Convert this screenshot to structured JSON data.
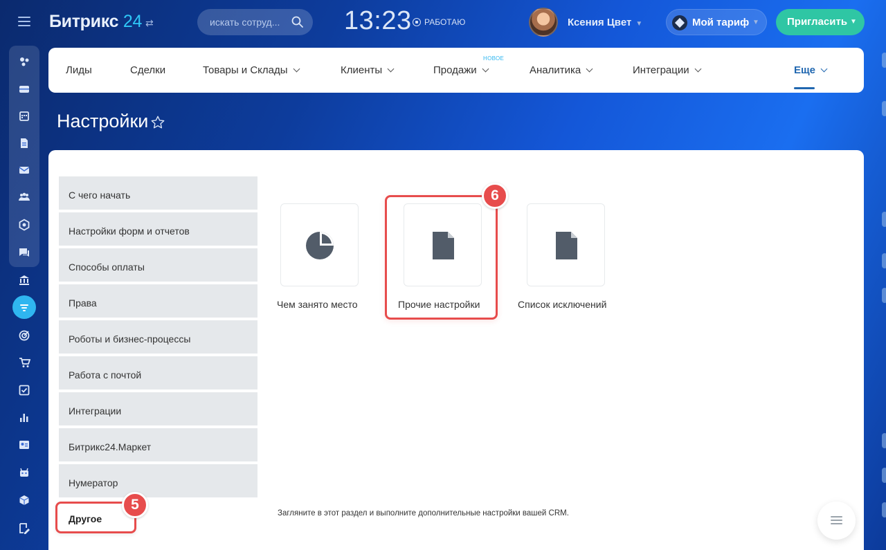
{
  "topbar": {
    "brand_name": "Битрикс",
    "brand_number": "24",
    "search_placeholder": "искать сотруд...",
    "clock": "13:23",
    "work_status": "РАБОТАЮ",
    "user_name": "Ксения Цвет",
    "tariff_label": "Мой тариф",
    "invite_label": "Пригласить"
  },
  "nav": {
    "items": [
      {
        "label": "Лиды"
      },
      {
        "label": "Сделки"
      },
      {
        "label": "Товары и Склады"
      },
      {
        "label": "Клиенты"
      },
      {
        "label": "Продажи"
      },
      {
        "label": "Аналитика"
      },
      {
        "label": "Интеграции"
      },
      {
        "label": "Еще"
      }
    ],
    "new_badge": "НОВОЕ"
  },
  "page": {
    "title": "Настройки"
  },
  "menu": {
    "items": [
      {
        "label": "С чего начать"
      },
      {
        "label": "Настройки форм и отчетов"
      },
      {
        "label": "Способы оплаты"
      },
      {
        "label": "Права"
      },
      {
        "label": "Роботы и бизнес-процессы"
      },
      {
        "label": "Работа с почтой"
      },
      {
        "label": "Интеграции"
      },
      {
        "label": "Битрикс24.Маркет"
      },
      {
        "label": "Нумератор"
      }
    ],
    "selected_label": "Другое"
  },
  "tiles": [
    {
      "label": "Чем занято место",
      "icon": "pie-chart-icon"
    },
    {
      "label": "Прочие настройки",
      "icon": "document-icon"
    },
    {
      "label": "Список исключений",
      "icon": "document-icon"
    }
  ],
  "hint": "Загляните в этот раздел и выполните дополнительные настройки вашей CRM.",
  "annotations": {
    "step5": "5",
    "step6": "6"
  },
  "colors": {
    "accent_red": "#e74c4c",
    "invite_green": "#2fc6a4",
    "link_blue": "#2067b0",
    "menu_bg": "#e5e8eb"
  }
}
